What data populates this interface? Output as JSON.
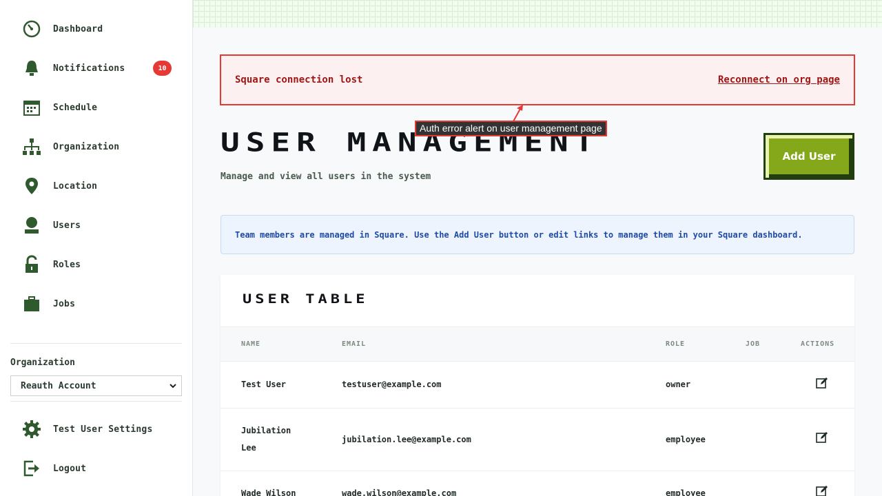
{
  "sidebar": {
    "items": [
      {
        "label": "Dashboard",
        "icon": "dashboard-icon"
      },
      {
        "label": "Notifications",
        "icon": "bell-icon",
        "badge": "10"
      },
      {
        "label": "Schedule",
        "icon": "calendar-icon"
      },
      {
        "label": "Organization",
        "icon": "org-chart-icon"
      },
      {
        "label": "Location",
        "icon": "map-pin-icon"
      },
      {
        "label": "Users",
        "icon": "user-icon"
      },
      {
        "label": "Roles",
        "icon": "lock-icon"
      },
      {
        "label": "Jobs",
        "icon": "briefcase-icon"
      }
    ],
    "org_label": "Organization",
    "org_selected": "Reauth Account",
    "settings_label": "Test User Settings",
    "logout_label": "Logout"
  },
  "alert": {
    "message": "Square connection lost",
    "link": "Reconnect on org page"
  },
  "annotation": "Auth error alert on user management page",
  "header": {
    "title": "USER MANAGEMENT",
    "subtitle": "Manage and view all users in the system",
    "add_button": "Add User"
  },
  "info": "Team members are managed in Square. Use the Add User button or edit links to manage them in your Square dashboard.",
  "table": {
    "title": "USER TABLE",
    "columns": [
      "NAME",
      "EMAIL",
      "ROLE",
      "JOB",
      "ACTIONS"
    ],
    "rows": [
      {
        "name": "Test User",
        "email": "testuser@example.com",
        "role": "owner",
        "job": ""
      },
      {
        "name": "Jubilation Lee",
        "name_lines": [
          "Jubilation",
          "Lee"
        ],
        "email": "jubilation.lee@example.com",
        "role": "employee",
        "job": ""
      },
      {
        "name": "Wade Wilson",
        "email": "wade.wilson@example.com",
        "role": "employee",
        "job": ""
      }
    ]
  },
  "colors": {
    "accent_green": "#85a81a",
    "icon_green": "#2e5a2e",
    "alert_red": "#e53935",
    "badge_red": "#e53935",
    "info_blue": "#1e4aa8"
  }
}
